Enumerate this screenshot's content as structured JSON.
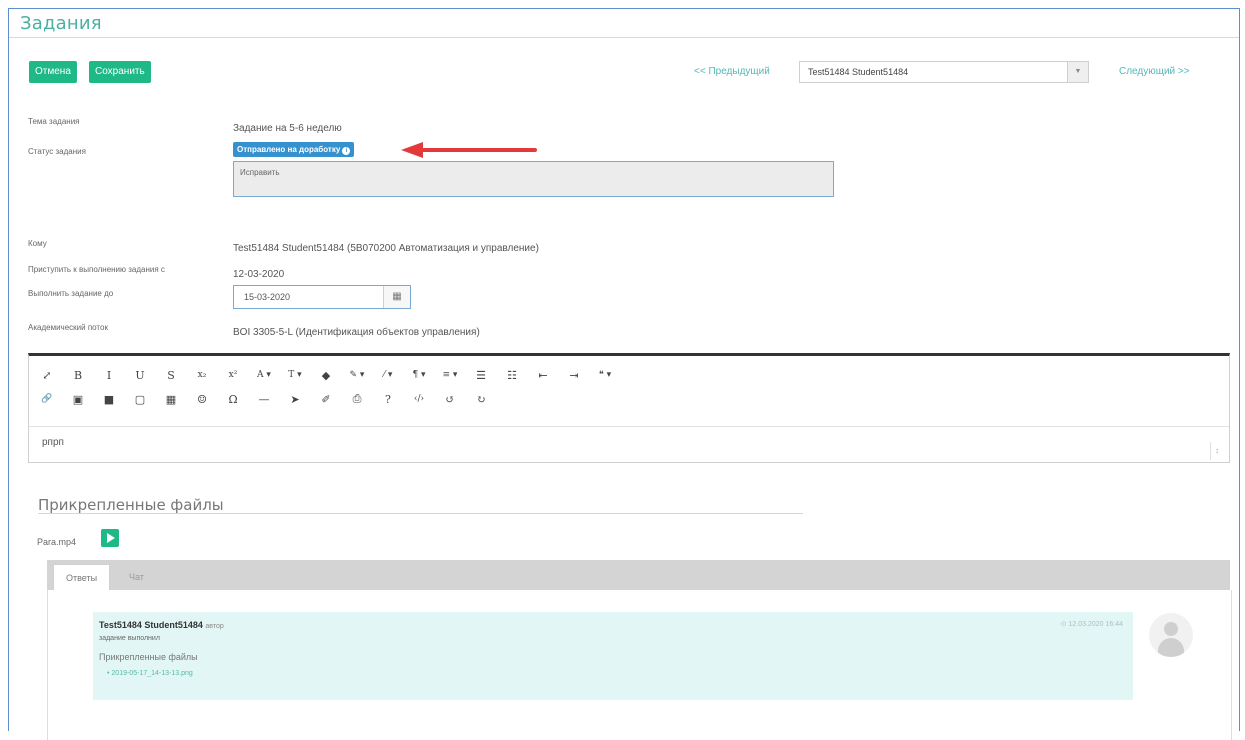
{
  "page": {
    "title": "Задания"
  },
  "toolbar": {
    "cancel_label": "Отмена",
    "save_label": "Сохранить",
    "prev_label": "<< Предыдущий",
    "next_label": "Следующий >>",
    "student_selected": "Test51484 Student51484"
  },
  "form": {
    "topic_label": "Тема задания",
    "topic_value": "Задание на 5-6 неделю",
    "status_label": "Статус задания",
    "status_value": "Отправлено на доработку",
    "comment_value": "Исправить",
    "to_label": "Кому",
    "to_value": "Test51484 Student51484 (5B070200 Автоматизация и управление)",
    "start_label": "Приступить к выполнению задания с",
    "start_value": "12-03-2020",
    "due_label": "Выполнить задание до",
    "due_value": "15-03-2020",
    "stream_label": "Академический поток",
    "stream_value": "BOI 3305-5-L (Идентификация объектов управления)"
  },
  "editor": {
    "row1": [
      "⤢",
      "B",
      "I",
      "U",
      "S",
      "x₂",
      "x²",
      "A ▾",
      "T ▾",
      "◆",
      "✎ ▾",
      "⁄ ▾",
      "¶ ▾",
      "≡ ▾",
      "☰",
      "☷",
      "⇤",
      "⇥",
      "❝ ▾"
    ],
    "row2": [
      "🔗",
      "▣",
      "■",
      "▢",
      "▦",
      "☺",
      "Ω",
      "—",
      "➤",
      "✐",
      "⎙",
      "?",
      "‹/›",
      "↺",
      "↻"
    ],
    "content": "рпрп"
  },
  "attachments": {
    "title": "Прикрепленные файлы",
    "file_name": "Para.mp4"
  },
  "tabs": [
    {
      "label": "Ответы"
    },
    {
      "label": "Чат"
    }
  ],
  "answer": {
    "author": "Test51484 Student51484",
    "role": "автор",
    "text": "задание выполнил",
    "files_title": "Прикрепленные файлы",
    "file": "2019-05-17_14-13-13.png",
    "time": "12.03.2020 16:44"
  },
  "colors": {
    "accent": "#1fb887",
    "title": "#4bb0a2",
    "status": "#3592cf",
    "arrow": "#e23a3a"
  }
}
